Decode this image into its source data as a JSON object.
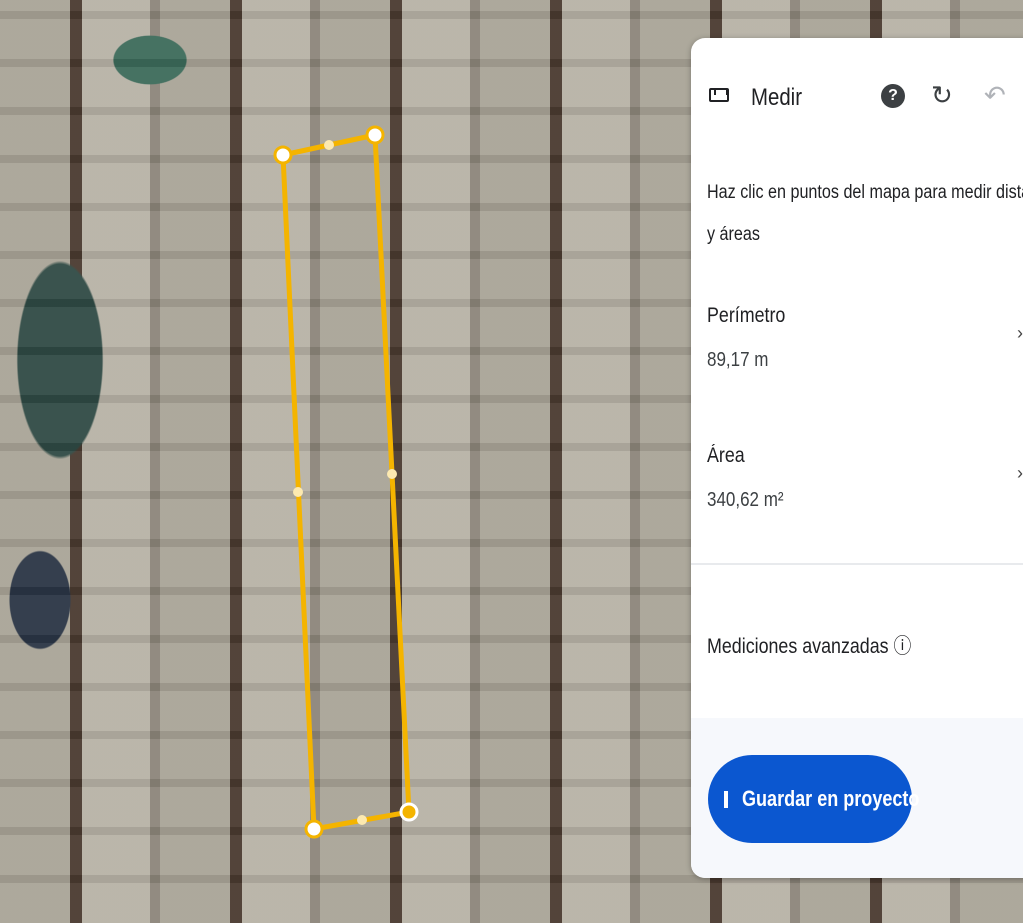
{
  "panel": {
    "title": "Medir",
    "help_label": "?",
    "description": "Haz clic en puntos del mapa para medir distan",
    "description_line2": "y áreas",
    "perimeter": {
      "label": "Perímetro",
      "value": "89,17 m"
    },
    "area": {
      "label": "Área",
      "value": "340,62 m²"
    },
    "advanced": {
      "label": "Mediciones avanzadas",
      "info": "ⓘ"
    },
    "save_button": "Guardar en proyecto"
  },
  "colors": {
    "measure_line": "#f4b400",
    "button": "#0b57d0"
  }
}
